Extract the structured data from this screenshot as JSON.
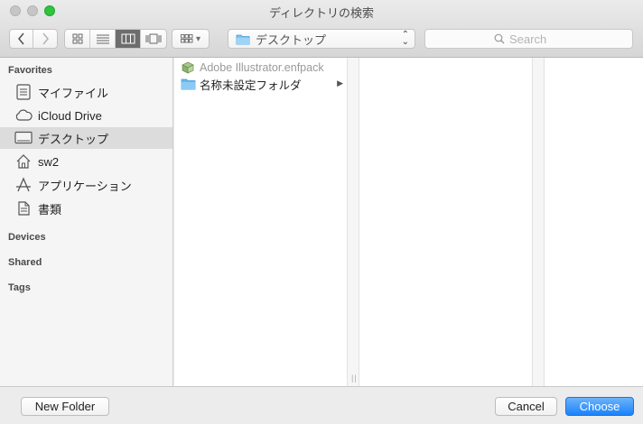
{
  "window": {
    "title": "ディレクトリの検索"
  },
  "toolbar": {
    "back_label": "‹",
    "forward_label": "›",
    "view_modes": [
      "icon",
      "list",
      "column",
      "cover-flow"
    ],
    "arrange_label": "▾",
    "path": {
      "label": "デスクトップ",
      "stepper": "⌃⌄"
    },
    "search": {
      "placeholder": "Search",
      "value": ""
    }
  },
  "sidebar": {
    "sections": {
      "favorites": "Favorites",
      "devices": "Devices",
      "shared": "Shared",
      "tags": "Tags"
    },
    "items": [
      {
        "label": "マイファイル",
        "icon": "all-my-files-icon"
      },
      {
        "label": "iCloud Drive",
        "icon": "cloud-icon"
      },
      {
        "label": "デスクトップ",
        "icon": "desktop-icon",
        "selected": true
      },
      {
        "label": "sw2",
        "icon": "home-icon"
      },
      {
        "label": "アプリケーション",
        "icon": "applications-icon"
      },
      {
        "label": "書類",
        "icon": "documents-icon"
      }
    ]
  },
  "browser": {
    "column1": [
      {
        "name": "Adobe Illustrator.enfpack",
        "icon": "package-icon",
        "disabled": true
      },
      {
        "name": "名称未設定フォルダ",
        "icon": "folder-icon",
        "has_children": true
      }
    ]
  },
  "bottom": {
    "new_folder": "New Folder",
    "cancel": "Cancel",
    "choose": "Choose"
  },
  "colors": {
    "accent": "#1a82fb",
    "folder": "#5fb3f0",
    "zoom": "#2fc43d"
  }
}
